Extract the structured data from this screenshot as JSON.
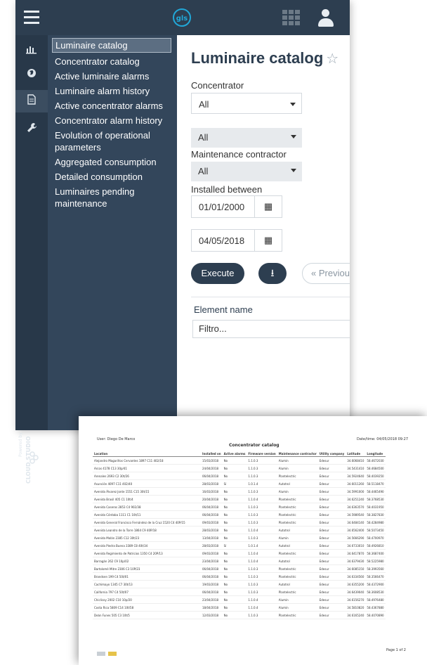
{
  "app": {
    "logo_text": "gls",
    "nav_icons": [
      "bar-chart-icon",
      "globe-icon",
      "document-icon",
      "wrench-icon"
    ],
    "powered_by": "Powered by",
    "brand": "CLOUD STUDIO"
  },
  "menu": {
    "items": [
      {
        "label": "Luminaire catalog",
        "selected": true
      },
      {
        "label": "Concentrator catalog"
      },
      {
        "label": "Active luminaire alarms"
      },
      {
        "label": "Luminaire alarm history"
      },
      {
        "label": "Active concentrator alarms"
      },
      {
        "label": "Concentrator alarm history"
      },
      {
        "label": "Evolution of operational parameters"
      },
      {
        "label": "Aggregated consumption"
      },
      {
        "label": "Detailed consumption"
      },
      {
        "label": "Luminaires pending maintenance"
      }
    ]
  },
  "form": {
    "title": "Luminaire catalog",
    "star": "☆",
    "concentrator_label": "Concentrator",
    "concentrator_value": "All",
    "second_value": "All",
    "maintenance_label": "Maintenance contractor",
    "maintenance_value": "All",
    "installed_label": "Installed between",
    "date_from": "01/01/2000",
    "date_to": "04/05/2018",
    "execute_label": "Execute",
    "previous_label": "« Previous",
    "element_name_label": "Element name",
    "filter_placeholder": "Filtro..."
  },
  "report": {
    "user": "User: Diego De Marco",
    "datetime": "Date/time: 04/05/2018 09:27",
    "title": "Concentrator catalog",
    "columns": [
      "Location",
      "Installed on",
      "Active alarms",
      "Firmware version",
      "Maintenance contractor",
      "Utility company",
      "Latitude",
      "Longitude"
    ],
    "rows": [
      [
        "Alejandro Magariños Cervantes 1897 C11 402/18",
        "15/03/2018",
        "No",
        "1.1.0.3",
        "Alumin",
        "Edesur",
        "34.6068410",
        "58.4672030"
      ],
      [
        "Arcos 4178 C13 30p/41",
        "24/04/2018",
        "No",
        "1.1.0.3",
        "Alumin",
        "Edesur",
        "34.5431410",
        "58.4684500"
      ],
      [
        "Arenales 2693 C2 30t/26",
        "06/04/2018",
        "No",
        "1.1.0.3",
        "Plantelectric",
        "Edesur",
        "34.5924640",
        "58.4039250"
      ],
      [
        "Asunción 4097 C11 402/40",
        "28/03/2018",
        "Sí",
        "1.0.1.4",
        "Autotrol",
        "Edesur",
        "34.6011260",
        "58.5118470"
      ],
      [
        "Avenida Álvarez Jonte 1551 C15 30t/15",
        "16/03/2018",
        "No",
        "1.1.0.3",
        "Alumin",
        "Edesur",
        "34.5991000",
        "58.4465490"
      ],
      [
        "Avenida Brasil 405 C1 10t/4",
        "20/04/2018",
        "No",
        "1.1.0.4",
        "Plantelectric",
        "Edesur",
        "34.6251240",
        "58.3768530"
      ],
      [
        "Avenida Caseros 2853 C4 902/38",
        "06/04/2018",
        "No",
        "1.1.0.3",
        "Plantelectric",
        "Edesur",
        "34.6363570",
        "58.4031950"
      ],
      [
        "Avenida Córdoba 1111 C1 10t/11",
        "06/04/2018",
        "No",
        "1.1.0.3",
        "Plantelectric",
        "Edesur",
        "34.5989540",
        "58.3827830"
      ],
      [
        "Avenida General Francisco Fernández de la Cruz 1520 C4 40P/15",
        "09/03/2018",
        "No",
        "1.1.0.3",
        "Plantelectric",
        "Edesur",
        "34.6484140",
        "58.4284980"
      ],
      [
        "Avenida Leandro de la Torre 1864 C9 40P/18",
        "28/03/2018",
        "No",
        "1.1.0.4",
        "Autotrol",
        "Edesur",
        "34.6562400",
        "58.5073450"
      ],
      [
        "Avenida Molán 2385 C12 30t/23",
        "13/04/2018",
        "No",
        "1.1.0.3",
        "Alumin",
        "Edesur",
        "34.5666290",
        "58.4700970"
      ],
      [
        "Avenida Piedra Buena 3389 C8 40t/34",
        "28/03/2018",
        "Sí",
        "1.0.1.4",
        "Autotrol",
        "Edesur",
        "34.6733010",
        "58.4926810"
      ],
      [
        "Avenida Regimiento de Patricios 1350 C4 20P/13",
        "09/03/2018",
        "No",
        "1.1.0.4",
        "Plantelectric",
        "Edesur",
        "34.6417870",
        "58.3687400"
      ],
      [
        "Barragán 262 C9 10p/02",
        "23/04/2018",
        "No",
        "1.1.0.4",
        "Autotrol",
        "Edesur",
        "34.6379430",
        "58.5225980"
      ],
      [
        "Bartolomé Mitre 2306 C3 10P/23",
        "06/04/2018",
        "No",
        "1.1.0.3",
        "Plantelectric",
        "Edesur",
        "34.6085150",
        "58.3993560"
      ],
      [
        "Brandsen 199 C4 50t/01",
        "06/04/2018",
        "No",
        "1.1.0.3",
        "Plantelectric",
        "Edesur",
        "34.6334560",
        "58.3566470"
      ],
      [
        "Cachimayo 1345 C7 30t/13",
        "19/03/2018",
        "No",
        "1.1.0.3",
        "Autotrol",
        "Edesur",
        "34.6355200",
        "58.4372900"
      ],
      [
        "California 797 C4 50t/07",
        "06/04/2018",
        "No",
        "1.1.0.3",
        "Plantelectric",
        "Edesur",
        "34.6439040",
        "58.3608530"
      ],
      [
        "Chiclicoy 2002 C10 10p/20",
        "23/04/2018",
        "No",
        "1.1.0.4",
        "Alumin",
        "Edesur",
        "34.6156270",
        "58.4976480"
      ],
      [
        "Costa Rica 5809 C14 10t/58",
        "18/04/2018",
        "No",
        "1.1.0.4",
        "Alumin",
        "Edesur",
        "34.5810820",
        "58.4367880"
      ],
      [
        "Deán Funes 505 C3 10t/5",
        "12/03/2018",
        "No",
        "1.1.0.3",
        "Plantelectric",
        "Edesur",
        "34.6165240",
        "58.4070890"
      ]
    ],
    "page": "Page 1 of 2"
  }
}
